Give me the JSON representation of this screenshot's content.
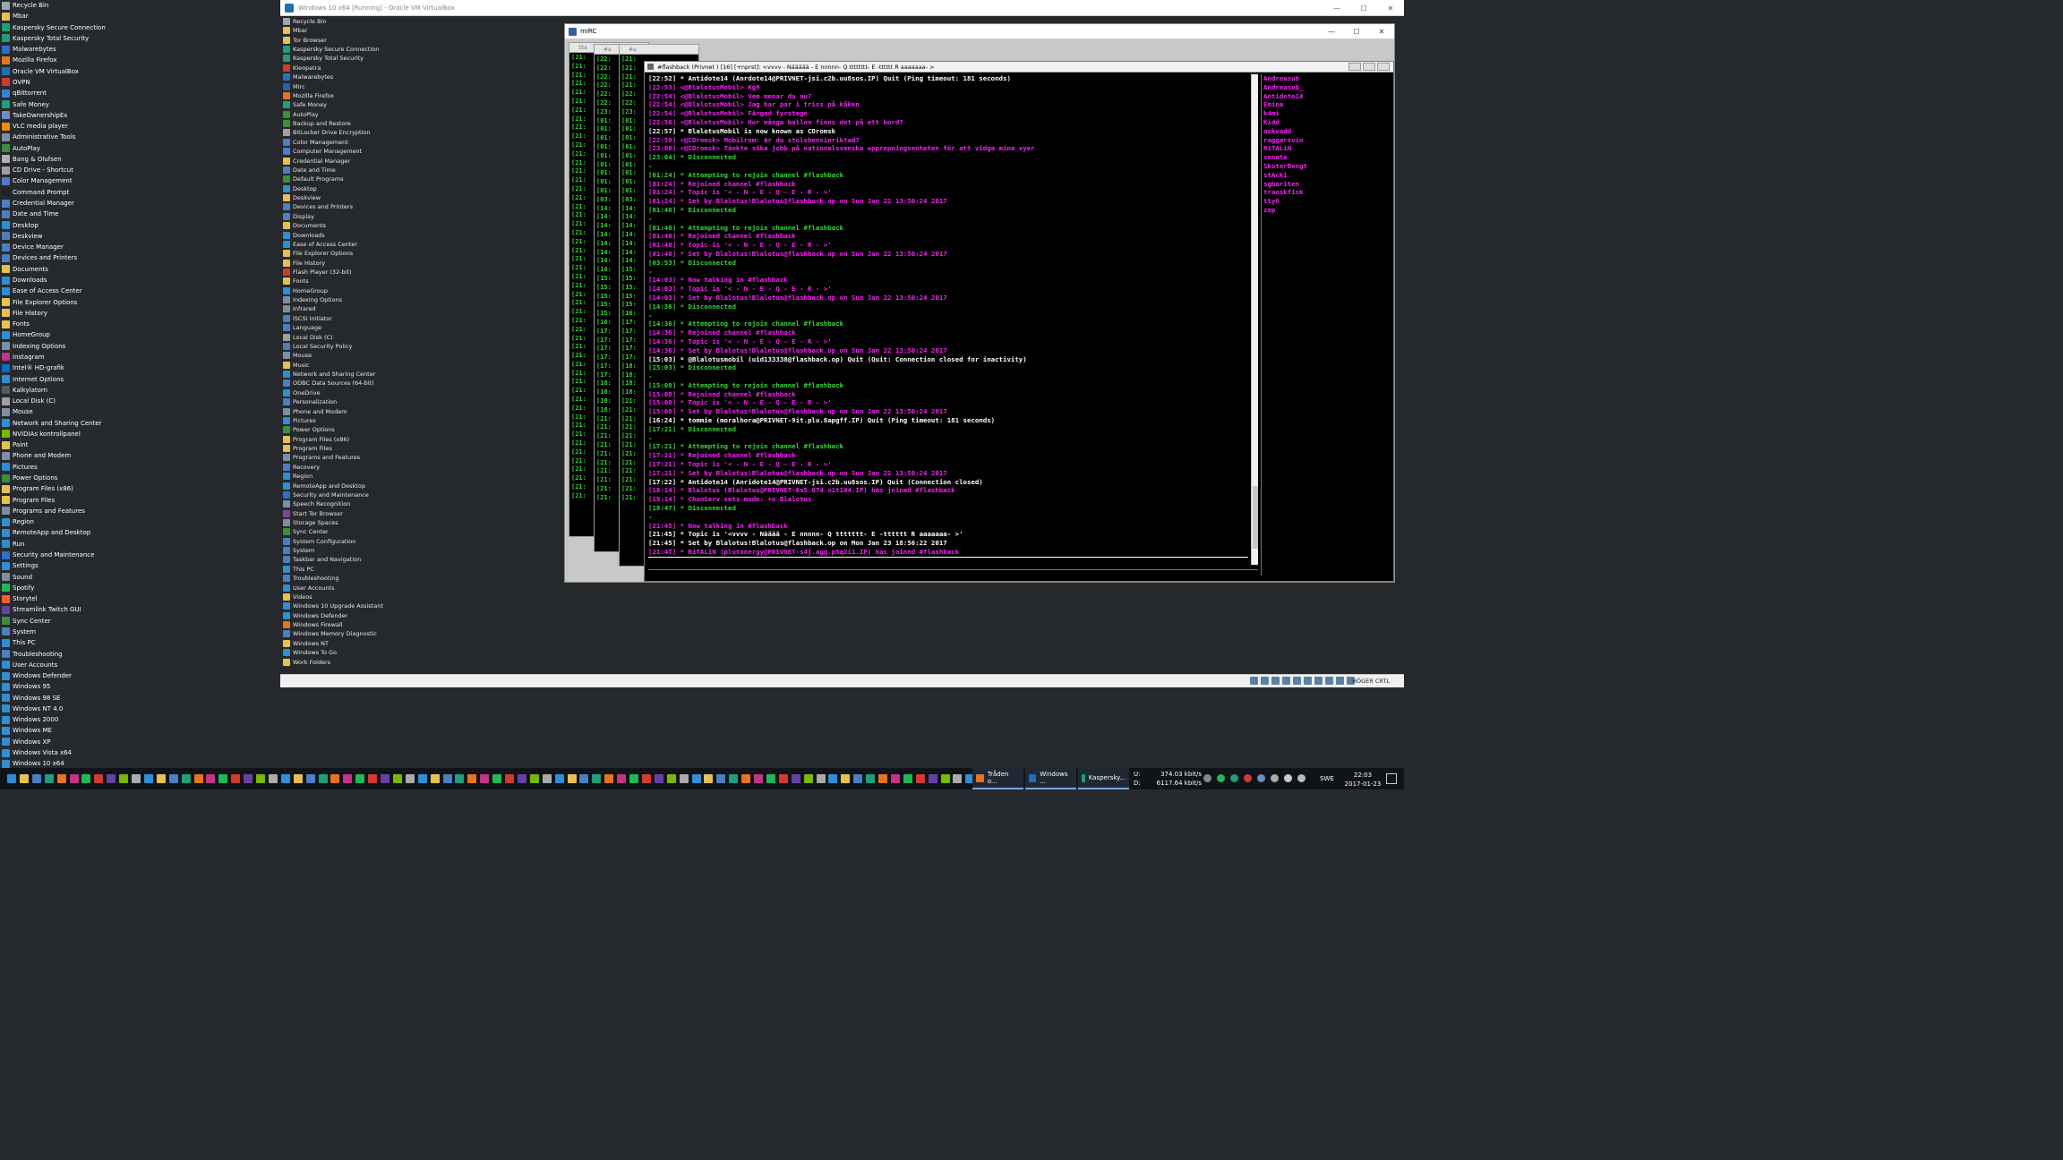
{
  "desktop_icons": [
    {
      "label": "Recycle Bin",
      "color": "#9aa7b4"
    },
    {
      "label": "Mbar",
      "color": "#e6c24d"
    },
    {
      "label": "Kaspersky Secure Connection",
      "color": "#1f9e7a"
    },
    {
      "label": "Kaspersky Total Security",
      "color": "#1f9e7a"
    },
    {
      "label": "Malwarebytes",
      "color": "#2d6fc9"
    },
    {
      "label": "Mozilla Firefox",
      "color": "#e8731d"
    },
    {
      "label": "Oracle VM VirtualBox",
      "color": "#1c6fb5"
    },
    {
      "label": "OVPN",
      "color": "#d23a2e"
    },
    {
      "label": "qBittorrent",
      "color": "#3c7ed6"
    },
    {
      "label": "Safe Money",
      "color": "#1f9e7a"
    },
    {
      "label": "TakeOwnershipEx",
      "color": "#6b8fc2"
    },
    {
      "label": "VLC media player",
      "color": "#f08c00"
    },
    {
      "label": "Administrative Tools",
      "color": "#7d8fa3"
    },
    {
      "label": "AutoPlay",
      "color": "#3c8e3c"
    },
    {
      "label": "Bang & Olufsen",
      "color": "#b0b0b0"
    },
    {
      "label": "CD Drive - Shortcut",
      "color": "#a0a0a0"
    },
    {
      "label": "Color Management",
      "color": "#4a7fc1"
    },
    {
      "label": "Command Prompt",
      "color": "#222222"
    },
    {
      "label": "Credential Manager",
      "color": "#4a7fc1"
    },
    {
      "label": "Date and Time",
      "color": "#4a7fc1"
    },
    {
      "label": "Desktop",
      "color": "#2d8fd6"
    },
    {
      "label": "Deskview",
      "color": "#4a7fc1"
    },
    {
      "label": "Device Manager",
      "color": "#4a7fc1"
    },
    {
      "label": "Devices and Printers",
      "color": "#4a7fc1"
    },
    {
      "label": "Documents",
      "color": "#e6c24d"
    },
    {
      "label": "Downloads",
      "color": "#2d8fd6"
    },
    {
      "label": "Ease of Access Center",
      "color": "#2d8fd6"
    },
    {
      "label": "File Explorer Options",
      "color": "#e6c24d"
    },
    {
      "label": "File History",
      "color": "#e6c24d"
    },
    {
      "label": "Fonts",
      "color": "#e6c24d"
    },
    {
      "label": "HomeGroup",
      "color": "#2d8fd6"
    },
    {
      "label": "Indexing Options",
      "color": "#7d8fa3"
    },
    {
      "label": "Instagram",
      "color": "#c13584"
    },
    {
      "label": "Intel® HD-grafik",
      "color": "#0071c5"
    },
    {
      "label": "Internet Options",
      "color": "#2d8fd6"
    },
    {
      "label": "Kalkylatorn",
      "color": "#5a5a5a"
    },
    {
      "label": "Local Disk (C)",
      "color": "#a0a0a0"
    },
    {
      "label": "Mouse",
      "color": "#7d8fa3"
    },
    {
      "label": "Network and Sharing Center",
      "color": "#2d8fd6"
    },
    {
      "label": "NVIDIAs kontrollpanel",
      "color": "#76b900"
    },
    {
      "label": "Paint",
      "color": "#e6c24d"
    },
    {
      "label": "Phone and Modem",
      "color": "#7d8fa3"
    },
    {
      "label": "Pictures",
      "color": "#2d8fd6"
    },
    {
      "label": "Power Options",
      "color": "#3c8e3c"
    },
    {
      "label": "Program Files (x86)",
      "color": "#e6c24d"
    },
    {
      "label": "Program Files",
      "color": "#e6c24d"
    },
    {
      "label": "Programs and Features",
      "color": "#7d8fa3"
    },
    {
      "label": "Region",
      "color": "#2d8fd6"
    },
    {
      "label": "RemoteApp and Desktop",
      "color": "#2d8fd6"
    },
    {
      "label": "Run",
      "color": "#2d8fd6"
    },
    {
      "label": "Security and Maintenance",
      "color": "#2d6fc9"
    },
    {
      "label": "Settings",
      "color": "#2d8fd6"
    },
    {
      "label": "Sound",
      "color": "#7d8fa3"
    },
    {
      "label": "Spotify",
      "color": "#1db954"
    },
    {
      "label": "Storytel",
      "color": "#ff5c28"
    },
    {
      "label": "Streamlink Twitch GUI",
      "color": "#6441a4"
    },
    {
      "label": "Sync Center",
      "color": "#3c8e3c"
    },
    {
      "label": "System",
      "color": "#4a7fc1"
    },
    {
      "label": "This PC",
      "color": "#2d8fd6"
    },
    {
      "label": "Troubleshooting",
      "color": "#4a7fc1"
    },
    {
      "label": "User Accounts",
      "color": "#2d8fd6"
    },
    {
      "label": "Windows Defender",
      "color": "#2d8fd6"
    },
    {
      "label": "Windows 95",
      "color": "#2d8fd6"
    },
    {
      "label": "Windows 98 SE",
      "color": "#2d8fd6"
    },
    {
      "label": "Windows NT 4.0",
      "color": "#2d8fd6"
    },
    {
      "label": "Windows 2000",
      "color": "#2d8fd6"
    },
    {
      "label": "Windows ME",
      "color": "#2d8fd6"
    },
    {
      "label": "Windows XP",
      "color": "#2d8fd6"
    },
    {
      "label": "Windows Vista x64",
      "color": "#2d8fd6"
    },
    {
      "label": "Windows 10 x64",
      "color": "#2d8fd6"
    }
  ],
  "vbox": {
    "title": "Windows 10 x64 [Running] - Oracle VM VirtualBox",
    "minimize": "—",
    "maximize": "☐",
    "close": "✕",
    "host_key": "HÖGER CRTL"
  },
  "guest_icons": [
    {
      "label": "Recycle Bin",
      "color": "#9aa7b4"
    },
    {
      "label": "Mbar",
      "color": "#e6c24d"
    },
    {
      "label": "Tor Browser",
      "color": "#e6c24d"
    },
    {
      "label": "Kaspersky Secure Connection",
      "color": "#1f9e7a"
    },
    {
      "label": "Kaspersky Total Security",
      "color": "#1f9e7a"
    },
    {
      "label": "Kleopatra",
      "color": "#d23a2e"
    },
    {
      "label": "Malwarebytes",
      "color": "#2d6fc9"
    },
    {
      "label": "Mirc",
      "color": "#2f5fa8"
    },
    {
      "label": "Mozilla Firefox",
      "color": "#e8731d"
    },
    {
      "label": "Safe Money",
      "color": "#1f9e7a"
    },
    {
      "label": "AutoPlay",
      "color": "#3c8e3c"
    },
    {
      "label": "Backup and Restore",
      "color": "#3c8e3c"
    },
    {
      "label": "BitLocker Drive Encryption",
      "color": "#a0a0a0"
    },
    {
      "label": "Color Management",
      "color": "#4a7fc1"
    },
    {
      "label": "Computer Management",
      "color": "#4a7fc1"
    },
    {
      "label": "Credential Manager",
      "color": "#e6c24d"
    },
    {
      "label": "Date and Time",
      "color": "#4a7fc1"
    },
    {
      "label": "Default Programs",
      "color": "#3c8e3c"
    },
    {
      "label": "Desktop",
      "color": "#2d8fd6"
    },
    {
      "label": "Deskview",
      "color": "#e6c24d"
    },
    {
      "label": "Devices and Printers",
      "color": "#4a7fc1"
    },
    {
      "label": "Display",
      "color": "#4a7fc1"
    },
    {
      "label": "Documents",
      "color": "#e6c24d"
    },
    {
      "label": "Downloads",
      "color": "#2d8fd6"
    },
    {
      "label": "Ease of Access Center",
      "color": "#2d8fd6"
    },
    {
      "label": "File Explorer Options",
      "color": "#e6c24d"
    },
    {
      "label": "File History",
      "color": "#e6c24d"
    },
    {
      "label": "Flash Player (32-bit)",
      "color": "#d23a2e"
    },
    {
      "label": "Fonts",
      "color": "#e6c24d"
    },
    {
      "label": "HomeGroup",
      "color": "#2d8fd6"
    },
    {
      "label": "Indexing Options",
      "color": "#7d8fa3"
    },
    {
      "label": "Infrared",
      "color": "#7d8fa3"
    },
    {
      "label": "iSCSI Initiator",
      "color": "#4a7fc1"
    },
    {
      "label": "Language",
      "color": "#4a7fc1"
    },
    {
      "label": "Local Disk (C)",
      "color": "#a0a0a0"
    },
    {
      "label": "Local Security Policy",
      "color": "#4a7fc1"
    },
    {
      "label": "Mouse",
      "color": "#7d8fa3"
    },
    {
      "label": "Music",
      "color": "#e6c24d"
    },
    {
      "label": "Network and Sharing Center",
      "color": "#2d8fd6"
    },
    {
      "label": "ODBC Data Sources (64-bit)",
      "color": "#4a7fc1"
    },
    {
      "label": "OneDrive",
      "color": "#2d8fd6"
    },
    {
      "label": "Personalization",
      "color": "#4a7fc1"
    },
    {
      "label": "Phone and Modem",
      "color": "#7d8fa3"
    },
    {
      "label": "Pictures",
      "color": "#2d8fd6"
    },
    {
      "label": "Power Options",
      "color": "#3c8e3c"
    },
    {
      "label": "Program Files (x86)",
      "color": "#e6c24d"
    },
    {
      "label": "Program Files",
      "color": "#e6c24d"
    },
    {
      "label": "Programs and Features",
      "color": "#7d8fa3"
    },
    {
      "label": "Recovery",
      "color": "#4a7fc1"
    },
    {
      "label": "Region",
      "color": "#2d8fd6"
    },
    {
      "label": "RemoteApp and Desktop",
      "color": "#2d8fd6"
    },
    {
      "label": "Security and Maintenance",
      "color": "#2d6fc9"
    },
    {
      "label": "Speech Recognition",
      "color": "#7d8fa3"
    },
    {
      "label": "Start Tor Browser",
      "color": "#7d4698"
    },
    {
      "label": "Storage Spaces",
      "color": "#7d8fa3"
    },
    {
      "label": "Sync Center",
      "color": "#3c8e3c"
    },
    {
      "label": "System Configuration",
      "color": "#4a7fc1"
    },
    {
      "label": "System",
      "color": "#4a7fc1"
    },
    {
      "label": "Taskbar and Navigation",
      "color": "#4a7fc1"
    },
    {
      "label": "This PC",
      "color": "#2d8fd6"
    },
    {
      "label": "Troubleshooting",
      "color": "#4a7fc1"
    },
    {
      "label": "User Accounts",
      "color": "#2d8fd6"
    },
    {
      "label": "Videos",
      "color": "#e6c24d"
    },
    {
      "label": "Windows 10 Upgrade Assistant",
      "color": "#2d8fd6"
    },
    {
      "label": "Windows Defender",
      "color": "#2d8fd6"
    },
    {
      "label": "Windows Firewall",
      "color": "#e8731d"
    },
    {
      "label": "Windows Memory Diagnostic",
      "color": "#4a7fc1"
    },
    {
      "label": "Windows NT",
      "color": "#e6c24d"
    },
    {
      "label": "Windows To Go",
      "color": "#2d8fd6"
    },
    {
      "label": "Work Folders",
      "color": "#e6c24d"
    }
  ],
  "mirc": {
    "title": "mIRC",
    "minimize": "—",
    "maximize": "☐",
    "close": "✕",
    "stack_labels": [
      "Sta",
      "#a",
      "#a"
    ],
    "channel_title": "#flashback (Privnet                 ) [16] [+nprst]: <vvvv - Näääää - E nnnnn- Q tttttttt- E -tttttt R aaaaaaa- >",
    "stack_ts_1": [
      "[21:",
      "[21:",
      "[21:",
      "[21:",
      "[21:",
      "[21:",
      "[21:",
      "[21:",
      "[21:",
      "[21:",
      "[21:",
      "[21:",
      "[21:",
      "[21:",
      "[21:",
      "[21:",
      "[21:",
      "[21:",
      "[21:",
      "[21:",
      "[21:",
      "[21:",
      "[21:",
      "[21:",
      "[21:",
      "[21:",
      "[21:",
      "[21:",
      "[21:",
      "[21:",
      "[21:",
      "[21:",
      "[21:",
      "[21:",
      "[21:",
      "[21:",
      "[21:",
      "[21:",
      "[21:",
      "[21:",
      "[21:",
      "[21:",
      "[21:",
      "[21:",
      "[21:",
      "[21:",
      "[21:",
      "[21:",
      "[21:",
      "[21:",
      "[21:"
    ],
    "stack_ts_2": [
      "[22:",
      "[22:",
      "[22:",
      "[22:",
      "[22:",
      "[22:",
      "[23:",
      "[01:",
      "[01:",
      "[01:",
      "[01:",
      "[01:",
      "[01:",
      "[01:",
      "[01:",
      "[01:",
      "[03:",
      "[14:",
      "[14:",
      "[14:",
      "[14:",
      "[14:",
      "[14:",
      "[14:",
      "[14:",
      "[15:",
      "[15:",
      "[15:",
      "[15:",
      "[15:",
      "[16:",
      "[17:",
      "[17:",
      "[17:",
      "[17:",
      "[17:",
      "[17:",
      "[18:",
      "[18:",
      "[18:",
      "[18:",
      "[21:",
      "[21:",
      "[21:",
      "[21:",
      "[21:",
      "[21:",
      "[21:",
      "[21:",
      "[21:",
      "[21:"
    ],
    "stack_ts_3": [
      "[21:",
      "[21:",
      "[21:",
      "[21:",
      "[22:",
      "[22:",
      "[23:",
      "[01:",
      "[01:",
      "[01:",
      "[01:",
      "[01:",
      "[01:",
      "[01:",
      "[01:",
      "[01:",
      "[03:",
      "[14:",
      "[14:",
      "[14:",
      "[14:",
      "[14:",
      "[14:",
      "[14:",
      "[15:",
      "[15:",
      "[15:",
      "[15:",
      "[15:",
      "[16:",
      "[17:",
      "[17:",
      "[17:",
      "[17:",
      "[17:",
      "[18:",
      "[18:",
      "[18:",
      "[18:",
      "[21:",
      "[21:",
      "[21:",
      "[21:",
      "[21:",
      "[21:",
      "[21:",
      "[21:",
      "[21:",
      "[21:",
      "[21:",
      "[21:"
    ],
    "log": [
      {
        "t": "[22:52] * Antidote14 (Anrdote14@PRIVNET-jsi.c2b.uu8sos.IP) Quit (Ping timeout: 181 seconds)",
        "c": "#ffffff"
      },
      {
        "t": "[22:53] <@BlalotusMobil> Kg9",
        "c": "#ff1dff"
      },
      {
        "t": "[22:54] <@BlalotusMobil> Vem menar du nu?",
        "c": "#ff1dff"
      },
      {
        "t": "[22:54] <@BlalotusMobil> Jag har par i triss på kåken",
        "c": "#ff1dff"
      },
      {
        "t": "[22:54] <@BlalotusMobil> Färgad fyrstege",
        "c": "#ff1dff"
      },
      {
        "t": "[22:56] <@BlalotusMobil> Hur många ballon finns det på ett bord?",
        "c": "#ff1dff"
      },
      {
        "t": "[22:57] * BlalotusMobil is now known as CDromsk",
        "c": "#ffffff"
      },
      {
        "t": "[22:58] <@CDromsk> Mobilrom: är du stolsbensinriktad?",
        "c": "#ff1dff"
      },
      {
        "t": "[23:00] <@CDromsk> Tänkte söka jobb på nationalsvenska upprepningsenheten för att vidga mina vyer",
        "c": "#ff1dff"
      },
      {
        "t": "[23:04] * Disconnected",
        "c": "#31d833"
      },
      {
        "t": "-",
        "c": "#31d833"
      },
      {
        "t": "[01:24] * Attempting to rejoin channel #flashback",
        "c": "#31d833"
      },
      {
        "t": "[01:24] * Rejoined channel #flashback",
        "c": "#ff1dff"
      },
      {
        "t": "[01:24] * Topic is '< - N - E - Q - E - R - >'",
        "c": "#ff1dff"
      },
      {
        "t": "[01:24] * Set by Blalotus!Blalotus@flashback.op on Sun Jan 22 13:50:24 2017",
        "c": "#ff1dff"
      },
      {
        "t": "[01:40] * Disconnected",
        "c": "#31d833"
      },
      {
        "t": "-",
        "c": "#31d833"
      },
      {
        "t": "[01:40] * Attempting to rejoin channel #flashback",
        "c": "#31d833"
      },
      {
        "t": "[01:40] * Rejoined channel #flashback",
        "c": "#ff1dff"
      },
      {
        "t": "[01:40] * Topic is '< - N - E - Q - E - R - >'",
        "c": "#ff1dff"
      },
      {
        "t": "[01:40] * Set by Blalotus!Blalotus@flashback.op on Sun Jan 22 13:50:24 2017",
        "c": "#ff1dff"
      },
      {
        "t": "[03:53] * Disconnected",
        "c": "#31d833"
      },
      {
        "t": "-",
        "c": "#31d833"
      },
      {
        "t": "[14:03] * Now talking in #flashback",
        "c": "#ff1dff"
      },
      {
        "t": "[14:03] * Topic is '< - N - E - Q - E - R - >'",
        "c": "#ff1dff"
      },
      {
        "t": "[14:03] * Set by Blalotus!Blalotus@flashback.op on Sun Jan 22 13:50:24 2017",
        "c": "#ff1dff"
      },
      {
        "t": "[14:36] * Disconnected",
        "c": "#31d833"
      },
      {
        "t": "-",
        "c": "#31d833"
      },
      {
        "t": "[14:36] * Attempting to rejoin channel #flashback",
        "c": "#31d833"
      },
      {
        "t": "[14:36] * Rejoined channel #flashback",
        "c": "#ff1dff"
      },
      {
        "t": "[14:36] * Topic is '< - N - E - Q - E - R - >'",
        "c": "#ff1dff"
      },
      {
        "t": "[14:36] * Set by Blalotus!Blalotus@flashback.op on Sun Jan 22 13:50:24 2017",
        "c": "#ff1dff"
      },
      {
        "t": "[15:03] * @Blalotusmobil (uid133338@flashback.op) Quit (Quit: Connection closed for inactivity)",
        "c": "#ffffff"
      },
      {
        "t": "[15:03] * Disconnected",
        "c": "#31d833"
      },
      {
        "t": "-",
        "c": "#31d833"
      },
      {
        "t": "[15:08] * Attempting to rejoin channel #flashback",
        "c": "#31d833"
      },
      {
        "t": "[15:08] * Rejoined channel #flashback",
        "c": "#ff1dff"
      },
      {
        "t": "[15:08] * Topic is '< - N - E - Q - E - R - >'",
        "c": "#ff1dff"
      },
      {
        "t": "[15:08] * Set by Blalotus!Blalotus@flashback.op on Sun Jan 22 13:50:24 2017",
        "c": "#ff1dff"
      },
      {
        "t": "[16:24] * tommie (moralhora@PRIVNET-9it.plu.8apgff.IP) Quit (Ping timeout: 181 seconds)",
        "c": "#ffffff"
      },
      {
        "t": "[17:21] * Disconnected",
        "c": "#31d833"
      },
      {
        "t": "-",
        "c": "#31d833"
      },
      {
        "t": "[17:21] * Attempting to rejoin channel #flashback",
        "c": "#31d833"
      },
      {
        "t": "[17:21] * Rejoined channel #flashback",
        "c": "#ff1dff"
      },
      {
        "t": "[17:21] * Topic is '< - N - E - Q - E - R - >'",
        "c": "#ff1dff"
      },
      {
        "t": "[17:21] * Set by Blalotus!Blalotus@flashback.op on Sun Jan 22 13:50:24 2017",
        "c": "#ff1dff"
      },
      {
        "t": "[17:22] * Antidote14 (Anridote14@PRIVNET-jsi.c2b.uu8sos.IP) Quit (Connection closed)",
        "c": "#ffffff"
      },
      {
        "t": "[18:14] * Blalotus (Blalotus@PRIVNET-6s5.074.o1t104.IP) has joined #flashback",
        "c": "#ff1dff"
      },
      {
        "t": "[18:14] * ChanServ sets mode: +o Blalotus",
        "c": "#ff1dff"
      },
      {
        "t": "[18:47] * Disconnected",
        "c": "#31d833"
      },
      {
        "t": "-",
        "c": "#31d833"
      },
      {
        "t": "[21:45] * Now talking in #flashback",
        "c": "#ff1dff"
      },
      {
        "t": "[21:45] * Topic is '<vvvv - Nääää - E nnnnn- Q ttttttt- E -tttttt R aaaaaaa- >'",
        "c": "#ffffff"
      },
      {
        "t": "[21:45] * Set by Blalotus!Blalotus@flashback.op on Mon Jan 23 18:56:22 2017",
        "c": "#ffffff"
      },
      {
        "t": "[21:47] * RiTALiN (plutonergy@PRIVNET-s4j.agg.p5q2i1.IP) has joined #flashback",
        "c": "#ff1dff"
      },
      {
        "t": "",
        "c": "#ffffff"
      },
      {
        "t": "[21:58] * RiTALiN (plutonergy@PRIVNET-s4j.agg.p5q2i1.IP) Quit (Ping timeout: 181 seconds)",
        "c": "#ffffff"
      },
      {
        "t": "[21:58] * RiTALiN (plutonergy@PRIVNET-s4j.agg.p5q2i1.IP) has joined #flashback",
        "c": "#ff1dff"
      }
    ],
    "nicks": [
      "Andreasub",
      "Andreasub_",
      "Antidote14",
      "Emina",
      "k4mi",
      "Kidd",
      "oskvadd",
      "raggarsvin",
      "RiTALiN",
      "senate",
      "SkoterBengt",
      "stAcki",
      "sgbariten",
      "traeskfisk",
      "tty0",
      "zep"
    ]
  },
  "taskbar": {
    "buttons": [
      {
        "label": "Tråden o...",
        "color": "#e8731d"
      },
      {
        "label": "Windows ...",
        "color": "#1c6fb5"
      },
      {
        "label": "Kaspersky...",
        "color": "#1f9e7a"
      }
    ],
    "net_up_label": "U:",
    "net_up": "374.03 kbit/s",
    "net_down_label": "D:",
    "net_down": "6117.64 kbit/s",
    "language": "SWE",
    "time": "22:03",
    "date": "2017-01-23"
  }
}
